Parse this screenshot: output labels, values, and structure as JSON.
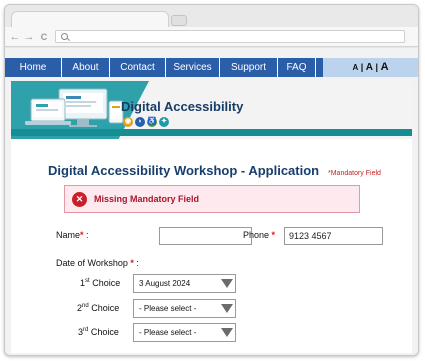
{
  "browser": {
    "nav_back": "←",
    "nav_forward": "→",
    "nav_reload": "C"
  },
  "nav": {
    "items": [
      {
        "label": "Home"
      },
      {
        "label": "About"
      },
      {
        "label": "Contact"
      },
      {
        "label": "Services"
      },
      {
        "label": "Support"
      },
      {
        "label": "FAQ"
      }
    ],
    "text_size": {
      "small": "A",
      "medium": "A",
      "large": "A",
      "separator": "|"
    }
  },
  "banner": {
    "site_title": "Digital Accessibility",
    "icons": [
      {
        "name": "vision-icon",
        "glyph": "◉",
        "color": "#e0a21a"
      },
      {
        "name": "hearing-icon",
        "glyph": "◗",
        "color": "#2a5ea9"
      },
      {
        "name": "mobility-icon",
        "glyph": "♿",
        "color": "#3f9a3f"
      },
      {
        "name": "cognitive-icon",
        "glyph": "✦",
        "color": "#1d9aa5"
      }
    ]
  },
  "form": {
    "title": "Digital Accessibility Workshop - Application",
    "mandatory_note": "*Mandatory Field",
    "error_message": "Missing Mandatory Field",
    "error_icon": "✕",
    "name_label": "Name",
    "name_value": "",
    "phone_label": "Phone",
    "phone_value": "9123 4567",
    "required_marker": "*",
    "date_label": "Date of Workshop",
    "choices": [
      {
        "num": "1",
        "sup": "st",
        "word": "Choice",
        "value": "3 August 2024"
      },
      {
        "num": "2",
        "sup": "nd",
        "word": "Choice",
        "value": "- Please select -"
      },
      {
        "num": "3",
        "sup": "rd",
        "word": "Choice",
        "value": "- Please select -"
      }
    ]
  }
}
